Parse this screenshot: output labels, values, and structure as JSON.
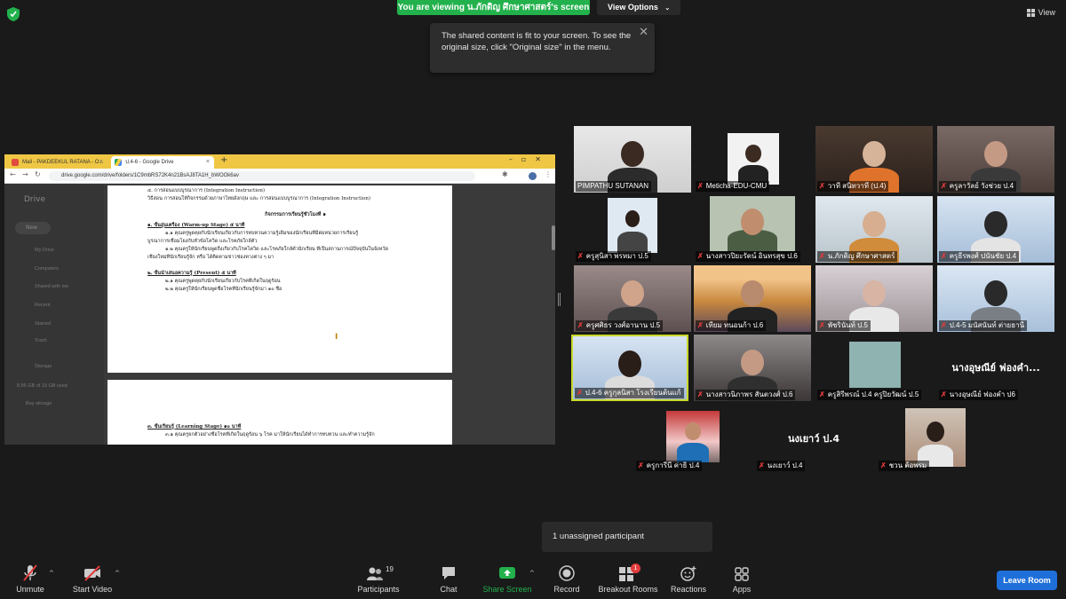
{
  "zoom": {
    "banner_text": "You are viewing น.ภักดิญ ศึกษาศาสตร์'s screen",
    "view_options_label": "View Options",
    "view_label": "View",
    "tooltip_text": "The shared content is fit to your screen. To see the original size, click \"Original size\" in the menu.",
    "unassigned_text": "1 unassigned participant",
    "leave_label": "Leave Room",
    "participants_count": "19",
    "breakout_badge": "1"
  },
  "toolbar": {
    "unmute": "Unmute",
    "start_video": "Start Video",
    "participants": "Participants",
    "chat": "Chat",
    "share_screen": "Share Screen",
    "record": "Record",
    "breakout_rooms": "Breakout Rooms",
    "reactions": "Reactions",
    "apps": "Apps"
  },
  "browser": {
    "tab1": "Mail - PAKDEEKUL RATANA - O...",
    "tab2": "ป.4-6 - Google Drive",
    "url": "drive.google.com/drive/folders/1C9mbRS72K4n21BsAJ8TA1H_bWOOk6av"
  },
  "drive": {
    "logo": "Drive",
    "new": "New",
    "menu": [
      "My Drive",
      "Computers",
      "Shared with me",
      "Recent",
      "Starred",
      "Trash",
      "Storage"
    ],
    "storage_used": "8.86 GB of 15 GB used",
    "buy_storage": "Buy storage"
  },
  "document": {
    "lines": [
      "๔. การสอนแบบบูรณาการ (Integration Instruction)",
      "วิธีสอน การสอนให้กิจกรรมด้วยภาษาไทยอังกฤษ และ การสอนแบบบูรณาการ (Integration Instruction)",
      "กิจกรรมการเรียนรู้ชั่วโมงที่ ๑",
      "๑. ขั้นอุ่นเครื่อง (Warm-up Stage) ๕ นาที",
      "๑.๑ คุณครูพูดคุยกับนักเรียนเกี่ยวกับการทบทวนความรู้เดิมของนักเรียนที่มีต่อหน่วยการเรียนรู้",
      "บูรณาการเชื่อมโยงกับหัวข้อโควิด และโรคภัยใกล้ตัว",
      "๑.๒ คุณครูให้นักเรียนพูดถึงเกี่ยวกับโรคโควิด และโรคภัยใกล้ตัวนักเรียน ที่เป็นสถานการณ์ปัจจุบันในจังหวัด",
      "เชียงใหม่ที่นักเรียนรู้จัก หรือ ได้ติดตามข่าวช่องทางต่าง ๆ มา",
      "๒. ขั้นนำเสนอความรู้ (Present) ๕ นาที",
      "๒.๑ คุณครูพูดคุยกับนักเรียนเกี่ยวกับโรคที่เกิดในฤดูร้อน",
      "๒.๒ คุณครูให้นักเรียนพูดชื่อโรคที่นักเรียนรู้จักมา ๑๐ ชื่อ",
      "๓. ขั้นเรียนรู้ (Learning Stage) ๑๐ นาที",
      "๓.๑ คุณครูยกตัวอย่างชื่อโรคที่เกิดในฤดูร้อน ๖ โรค มาให้นักเรียนได้ทำการทบทวน และทำความรู้จัก"
    ]
  },
  "participants": [
    {
      "name": "PIMPATHU SUTANAN",
      "muted": false
    },
    {
      "name": "Meticha-EDU-CMU",
      "muted": true
    },
    {
      "name": "วาที สนิทวาที (ป.4)",
      "muted": true
    },
    {
      "name": "ครูลาวัลย์ วังช่วย ป.4",
      "muted": true
    },
    {
      "name": "ครูสุนิสา พรหมา ป.5",
      "muted": true
    },
    {
      "name": "นางสาวปิยะรัตน์ อินทรสุข ป.6",
      "muted": true
    },
    {
      "name": "น.ภักดิญ ศึกษาศาสตร์",
      "muted": true
    },
    {
      "name": "ครูธีรพงศ์ ปนันชัย ป.4",
      "muted": true
    },
    {
      "name": "ครูศศิธร วงศ์อานาน ป.5",
      "muted": true
    },
    {
      "name": "เทียม ทนอนก้า ป.6",
      "muted": true
    },
    {
      "name": "พัชรินันท์ ป.5",
      "muted": true
    },
    {
      "name": "ป.4-5 มนัสนันท์ ต่ายธานี",
      "muted": true
    },
    {
      "name": "ป.4-6 ครูกุลนิสา โรงเรียนต้นแก้",
      "muted": true
    },
    {
      "name": "นางสาวนิภาพร สันตวงศ์ ป.6",
      "muted": true
    },
    {
      "name": "ครูสิรีพรณ์ ป.4 ครูปิยวัฒน์ ป.5",
      "muted": true
    },
    {
      "name": "นางอุษณีย์ ฟองคำ ป6",
      "muted": true,
      "big": "นางอุษณีย์ ฟองคำ..."
    },
    {
      "name": "ครูการีนี ค่าธิ ป.4",
      "muted": true
    },
    {
      "name": "นงเยาว์ ป.4",
      "muted": true,
      "big": "นงเยาว์ ป.4"
    },
    {
      "name": "ชวน ต้อพรม",
      "muted": true
    }
  ],
  "colors": {
    "banner": "#22b14c",
    "mute_red": "#e23b3b",
    "share_green": "#22b14c",
    "leave_blue": "#1e6fd9",
    "active_speaker": "#c8d82a"
  }
}
